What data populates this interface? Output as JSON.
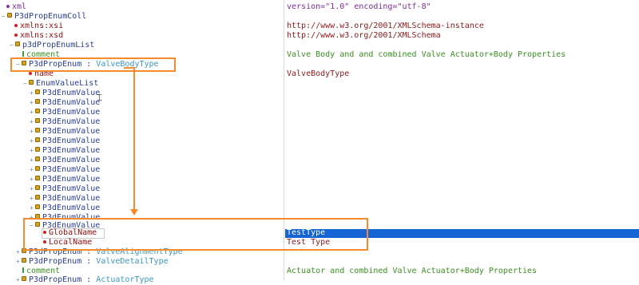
{
  "tree": {
    "xml": "xml",
    "root": "P3dPropEnumColl",
    "xmlns_xsi": "xmlns:xsi",
    "xmlns_xsd": "xmlns:xsd",
    "list": "p3dPropEnumList",
    "comment": "comment",
    "prop_enum": "P3dPropEnum",
    "sep": " : ",
    "prop_enum_type": "ValveBodyType",
    "name": "name",
    "enum_value_list": "EnumValueList",
    "enum_values": [
      "P3dEnumValue",
      "P3dEnumValue",
      "P3dEnumValue",
      "P3dEnumValue",
      "P3dEnumValue",
      "P3dEnumValue",
      "P3dEnumValue",
      "P3dEnumValue",
      "P3dEnumValue",
      "P3dEnumValue",
      "P3dEnumValue",
      "P3dEnumValue",
      "P3dEnumValue",
      "P3dEnumValue"
    ],
    "last_enum_value": "P3dEnumValue",
    "global_name": "GlobalName",
    "local_name": "LocalName",
    "prop_enum_2_type": "ValveAlignmentType",
    "prop_enum_3_type": "ValveDetailType",
    "comment_2": "comment",
    "prop_enum_4_type": "ActuatorType"
  },
  "values": {
    "xml": "version=\"1.0\" encoding=\"utf-8\"",
    "xsi": "http://www.w3.org/2001/XMLSchema-instance",
    "xsd": "http://www.w3.org/2001/XMLSchema",
    "comment": "Valve Body and and combined Valve Actuator+Body Properties",
    "name": "ValveBodyType",
    "global_name": "TestType",
    "local_name": "Test Type",
    "comment_2": "Actuator and combined Valve Actuator+Body Properties"
  },
  "colors": {
    "highlight_box": "#f58b2c",
    "selection": "#1464d4",
    "element_text": "#2a3f95",
    "type_text": "#3c96c8",
    "comment_text": "#3b8f22"
  }
}
